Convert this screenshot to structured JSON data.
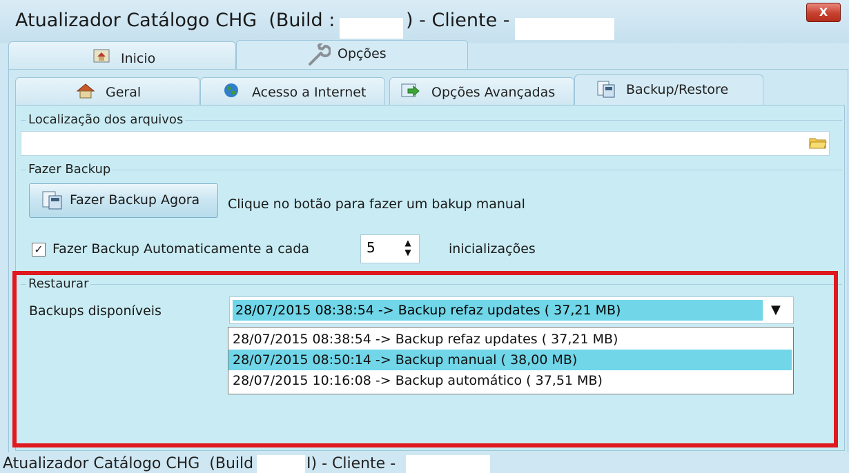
{
  "window": {
    "title_prefix": "Atualizador Catálogo CHG  (Build :",
    "title_mid": ") - Cliente -",
    "close_glyph": "X"
  },
  "top_tabs": [
    {
      "label": "Inicio",
      "icon": "home-screen-icon"
    },
    {
      "label": "Opções",
      "icon": "wrench-icon"
    }
  ],
  "sub_tabs": [
    {
      "label": "Geral",
      "icon": "house-icon"
    },
    {
      "label": "Acesso a Internet",
      "icon": "globe-icon"
    },
    {
      "label": "Opções Avançadas",
      "icon": "arrow-window-icon"
    },
    {
      "label": "Backup/Restore",
      "icon": "backup-icon"
    }
  ],
  "location": {
    "group_label": "Localização dos arquivos",
    "path_value": "",
    "folder_icon": "folder-icon"
  },
  "backup": {
    "group_label": "Fazer Backup",
    "button_label": "Fazer Backup Agora",
    "hint": "Clique no botão para fazer um bakup manual",
    "auto_label": "Fazer Backup Automaticamente a cada",
    "auto_checked": true,
    "check_glyph": "✓",
    "count": "5",
    "suffix": "inicializações"
  },
  "restore": {
    "group_label": "Restaurar",
    "available_label": "Backups disponíveis",
    "selected": "28/07/2015 08:38:54 -> Backup refaz updates (   37,21 MB)",
    "options": [
      "28/07/2015 08:38:54 -> Backup refaz updates (   37,21 MB)",
      "28/07/2015 08:50:14 -> Backup manual (   38,00 MB)",
      "28/07/2015 10:16:08 -> Backup automático (   37,51 MB)"
    ]
  },
  "status": {
    "prefix": "Atualizador Catálogo CHG  (Build",
    "mid": "I) - Cliente -"
  },
  "colors": {
    "highlight_border": "#e0191e",
    "selection": "#70d6e8"
  }
}
